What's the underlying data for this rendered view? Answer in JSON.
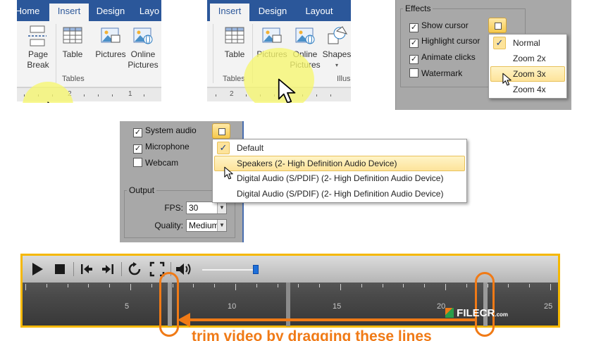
{
  "ribbon1": {
    "tabs": [
      {
        "label": "Home"
      },
      {
        "label": "Insert"
      },
      {
        "label": "Design"
      },
      {
        "label": "Layo"
      }
    ],
    "buttons": {
      "page_break": "Page\nBreak",
      "table": "Table",
      "pictures": "Pictures",
      "online_pictures": "Online\nPictures"
    },
    "group_tables": "Tables",
    "ruler_numbers": [
      "2",
      "1"
    ]
  },
  "ribbon2": {
    "tabs": [
      {
        "label": "Insert"
      },
      {
        "label": "Design"
      },
      {
        "label": "Layout"
      }
    ],
    "buttons": {
      "table": "Table",
      "pictures": "Pictures",
      "online_pictures": "Online\nPictures",
      "shapes": "Shapes"
    },
    "group_tables": "Tables",
    "group_illus": "Illus",
    "ruler_numbers": [
      "2"
    ]
  },
  "effects": {
    "legend": "Effects",
    "options": [
      {
        "label": "Show cursor",
        "checked": true
      },
      {
        "label": "Highlight cursor",
        "checked": true
      },
      {
        "label": "Animate clicks",
        "checked": true
      },
      {
        "label": "Watermark",
        "checked": false
      }
    ],
    "zoom_menu": [
      "Normal",
      "Zoom 2x",
      "Zoom 3x",
      "Zoom 4x"
    ],
    "zoom_checked_index": 0,
    "zoom_hover_index": 2
  },
  "audio": {
    "options": [
      {
        "label": "System audio",
        "checked": true
      },
      {
        "label": "Microphone",
        "checked": true
      },
      {
        "label": "Webcam",
        "checked": false
      }
    ],
    "device_menu": [
      "Default",
      "Speakers (2- High Definition Audio Device)",
      "Digital Audio (S/PDIF) (2- High Definition Audio Device)",
      "Digital Audio (S/PDIF) (2- High Definition Audio Device)"
    ],
    "device_checked_index": 0,
    "device_hover_index": 1,
    "output_legend": "Output",
    "fps_label": "FPS:",
    "fps_value": "30",
    "quality_label": "Quality:",
    "quality_value": "Medium"
  },
  "player": {
    "timeline_numbers": [
      "5",
      "10",
      "15",
      "20",
      "25"
    ],
    "volume_level": 0.95,
    "caption": "trim video by dragging these lines",
    "accent": "#f5b800",
    "annotation_color": "#f07a16"
  },
  "watermark": {
    "brand": "FILECR",
    "domain": ".com"
  }
}
